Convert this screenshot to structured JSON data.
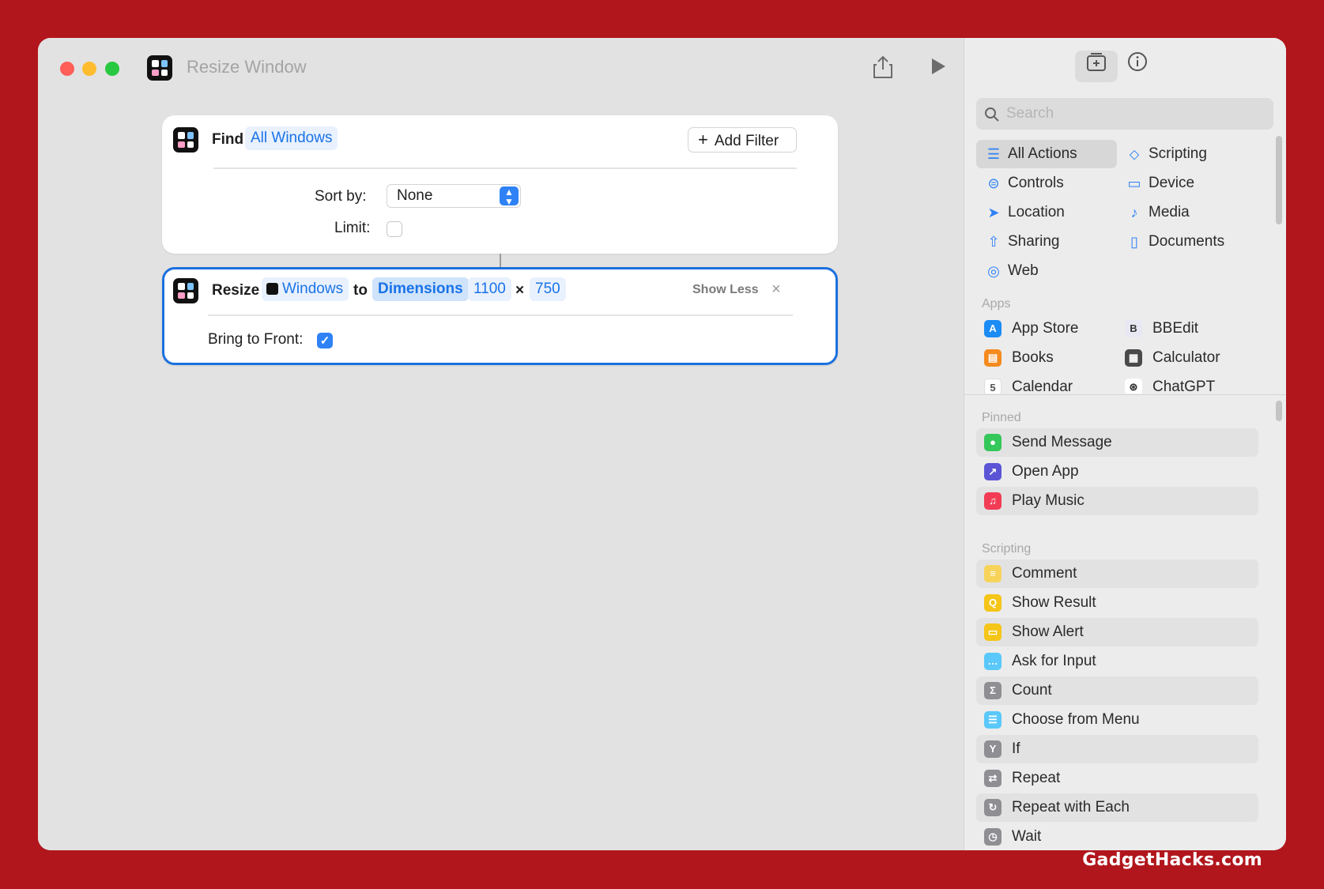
{
  "window": {
    "title": "Resize Window"
  },
  "find_action": {
    "verb": "Find",
    "target": "All Windows",
    "add_filter": "Add Filter",
    "sort_label": "Sort by:",
    "sort_value": "None",
    "limit_label": "Limit:",
    "limit_checked": false
  },
  "resize_action": {
    "verb": "Resize",
    "target": "Windows",
    "to": "to",
    "mode": "Dimensions",
    "width": "1100",
    "times": "×",
    "height": "750",
    "show_less": "Show Less",
    "bring_label": "Bring to Front:",
    "bring_checked": true
  },
  "sidebar": {
    "search_placeholder": "Search",
    "categories": [
      {
        "label": "All Actions",
        "icon": "list-icon",
        "selected": true
      },
      {
        "label": "Scripting",
        "icon": "scripting-icon"
      },
      {
        "label": "Controls",
        "icon": "toggles-icon"
      },
      {
        "label": "Device",
        "icon": "display-icon"
      },
      {
        "label": "Location",
        "icon": "location-arrow-icon"
      },
      {
        "label": "Media",
        "icon": "music-note-icon"
      },
      {
        "label": "Sharing",
        "icon": "share-icon"
      },
      {
        "label": "Documents",
        "icon": "document-icon"
      },
      {
        "label": "Web",
        "icon": "compass-icon"
      }
    ],
    "apps_header": "Apps",
    "apps": [
      {
        "label": "App Store",
        "color": "#1b8cf5",
        "glyph": "A"
      },
      {
        "label": "BBEdit",
        "color": "#e8e8f4",
        "glyph": "B"
      },
      {
        "label": "Books",
        "color": "#f58a1f",
        "glyph": "▤"
      },
      {
        "label": "Calculator",
        "color": "#4a4a4a",
        "glyph": "▦"
      },
      {
        "label": "Calendar",
        "color": "#ffffff",
        "glyph": "5"
      },
      {
        "label": "ChatGPT",
        "color": "#ffffff",
        "glyph": "⊛"
      }
    ],
    "pinned_header": "Pinned",
    "pinned": [
      {
        "label": "Send Message",
        "color": "#34c759",
        "glyph": "💬"
      },
      {
        "label": "Open App",
        "color": "#5b55d6",
        "glyph": "↗"
      },
      {
        "label": "Play Music",
        "color": "#f23c55",
        "glyph": "♫"
      }
    ],
    "scripting_header": "Scripting",
    "scripting": [
      {
        "label": "Comment",
        "color": "#f7d35a",
        "glyph": "≡"
      },
      {
        "label": "Show Result",
        "color": "#f5c518",
        "glyph": "Q"
      },
      {
        "label": "Show Alert",
        "color": "#f5c518",
        "glyph": "▭"
      },
      {
        "label": "Ask for Input",
        "color": "#5ac8fa",
        "glyph": "…"
      },
      {
        "label": "Count",
        "color": "#8e8e93",
        "glyph": "Σ"
      },
      {
        "label": "Choose from Menu",
        "color": "#5ac8fa",
        "glyph": "☰"
      },
      {
        "label": "If",
        "color": "#8e8e93",
        "glyph": "Y"
      },
      {
        "label": "Repeat",
        "color": "#8e8e93",
        "glyph": "⇄"
      },
      {
        "label": "Repeat with Each",
        "color": "#8e8e93",
        "glyph": "↻"
      },
      {
        "label": "Wait",
        "color": "#8e8e93",
        "glyph": "◷"
      }
    ]
  },
  "watermark": "GadgetHacks.com"
}
